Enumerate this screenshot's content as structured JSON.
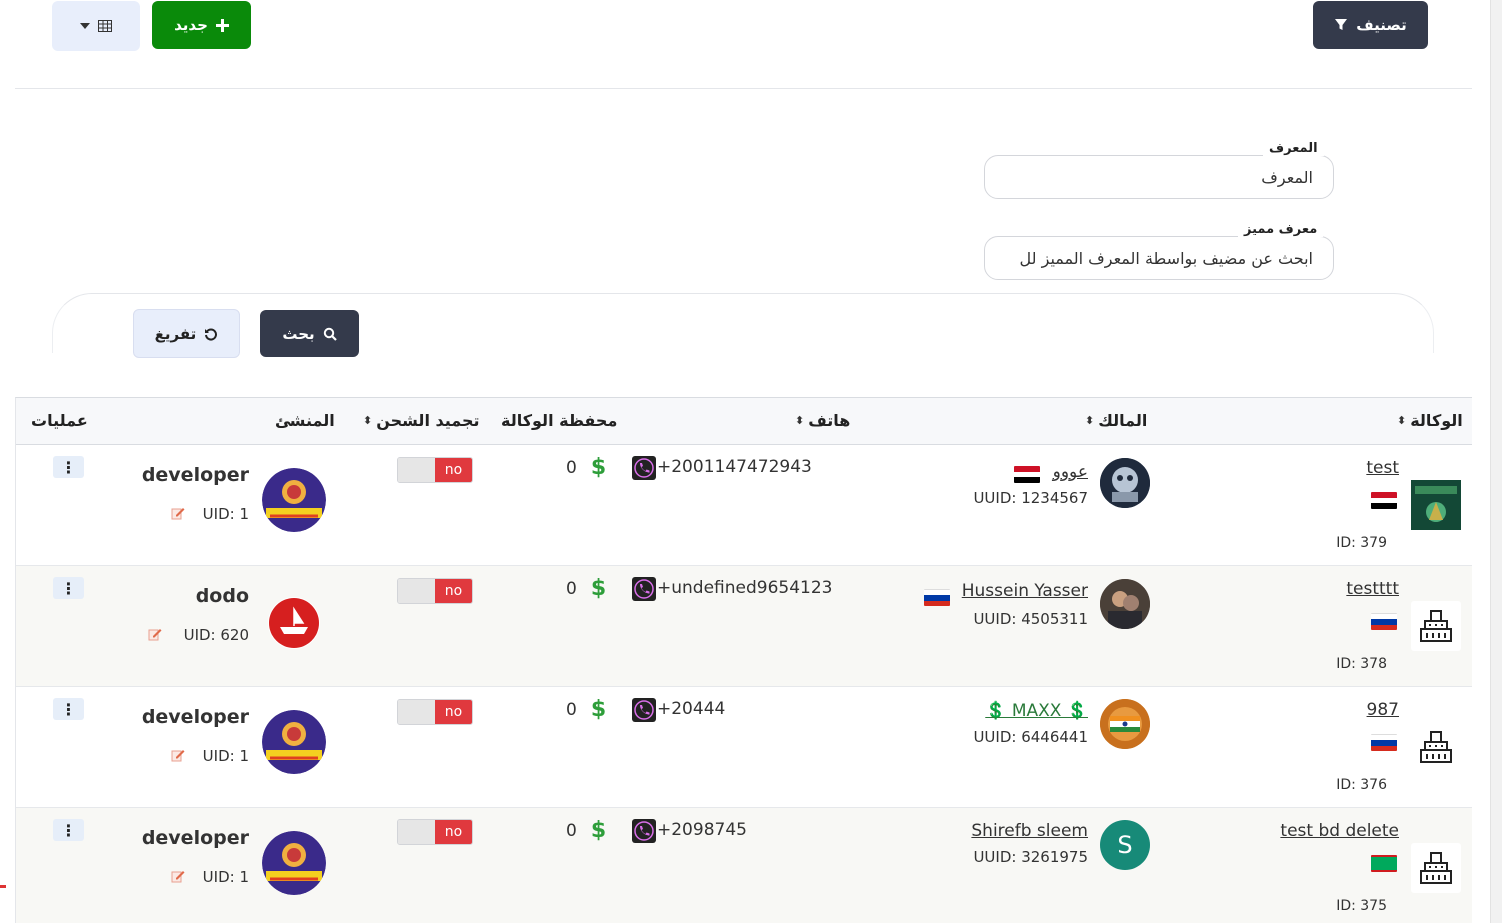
{
  "toolbar": {
    "filter_label": "تصنيف",
    "new_label": "جديد"
  },
  "form": {
    "id_label": "المعرف",
    "id_placeholder": "المعرف",
    "uid_label": "معرف مميز",
    "uid_placeholder": "ابحث عن مضيف بواسطة المعرف المميز لل",
    "search_label": "بحث",
    "clear_label": "تفريغ"
  },
  "table": {
    "headers": {
      "agency": "الوكالة",
      "owner": "المالك",
      "phone": "هاتف",
      "wallet": "محفظة الوكالة",
      "freeze": "تجميد الشحن",
      "creator": "المنشئ",
      "ops": "عمليات"
    },
    "rows": [
      {
        "agency_name": "test",
        "agency_id": "ID: 379",
        "agency_flag": "egypt",
        "owner_name": "عووو",
        "owner_flag": "egypt",
        "owner_uuid": "UUID: 1234567",
        "phone": "+2001147472943",
        "wallet": "0",
        "wallet_icon": "$",
        "freeze": "no",
        "creator_name": "developer",
        "creator_uid": "UID: 1"
      },
      {
        "agency_name": "testttt",
        "agency_id": "ID: 378",
        "agency_flag": "russia",
        "owner_name": "Hussein Yasser",
        "owner_flag": "russia",
        "owner_uuid": "UUID: 4505311",
        "phone": "+undefined9654123",
        "wallet": "0",
        "wallet_icon": "$",
        "freeze": "no",
        "creator_name": "dodo",
        "creator_uid": "UID: 620"
      },
      {
        "agency_name": "987",
        "agency_id": "ID: 376",
        "agency_flag": "russia",
        "owner_name": "💲 MAXX 💲",
        "owner_flag": "",
        "owner_uuid": "UUID: 6446441",
        "phone": "+20444",
        "wallet": "0",
        "wallet_icon": "$",
        "freeze": "no",
        "creator_name": "developer",
        "creator_uid": "UID: 1"
      },
      {
        "agency_name": "test bd delete",
        "agency_id": "ID: 375",
        "agency_flag": "mauritania",
        "owner_name": "Shirefb sleem",
        "owner_flag": "",
        "owner_uuid": "UUID: 3261975",
        "owner_initial": "S",
        "phone": "+2098745",
        "wallet": "0",
        "wallet_icon": "$",
        "freeze": "no",
        "creator_name": "developer",
        "creator_uid": "UID: 1"
      }
    ]
  },
  "colors": {
    "dark_button": "#343a4b",
    "green_button": "#0a8a0a",
    "toggle_red": "#e0393e",
    "dollar_green": "#2e9e3a"
  }
}
